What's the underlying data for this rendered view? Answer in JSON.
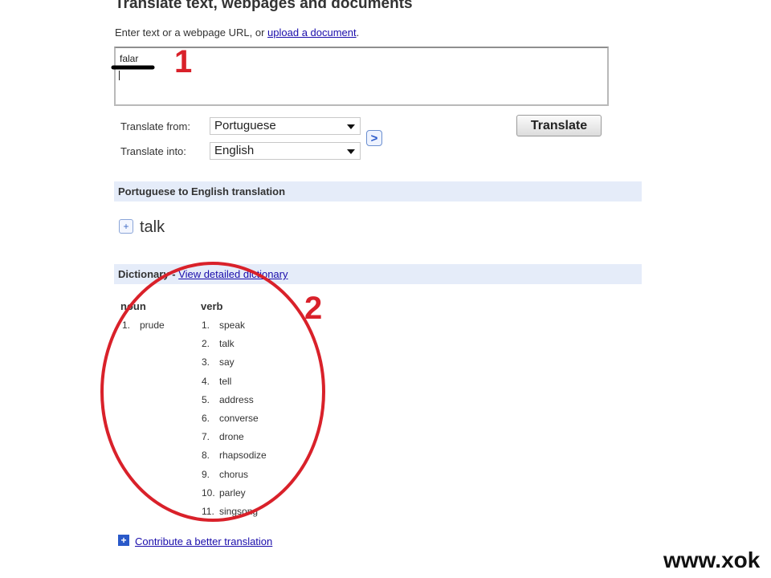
{
  "header": {
    "title": "Translate text, webpages and documents",
    "subtitle_prefix": "Enter text or a webpage URL, or ",
    "upload_link": "upload a document",
    "subtitle_suffix": "."
  },
  "input": {
    "value": "falar"
  },
  "controls": {
    "from_label": "Translate from:",
    "from_value": "Portuguese",
    "into_label": "Translate into:",
    "into_value": "English",
    "translate_button": "Translate"
  },
  "result_bar": {
    "label": "Portuguese to English translation"
  },
  "result": {
    "text": "talk"
  },
  "dictionary": {
    "label": "Dictionary",
    "link": "View detailed dictionary",
    "noun_head": "noun",
    "noun_items": [
      {
        "n": "1.",
        "w": "prude"
      }
    ],
    "verb_head": "verb",
    "verb_items": [
      {
        "n": "1.",
        "w": "speak"
      },
      {
        "n": "2.",
        "w": "talk"
      },
      {
        "n": "3.",
        "w": "say"
      },
      {
        "n": "4.",
        "w": "tell"
      },
      {
        "n": "5.",
        "w": "address"
      },
      {
        "n": "6.",
        "w": "converse"
      },
      {
        "n": "7.",
        "w": "drone"
      },
      {
        "n": "8.",
        "w": "rhapsodize"
      },
      {
        "n": "9.",
        "w": "chorus"
      },
      {
        "n": "10.",
        "w": "parley"
      },
      {
        "n": "11.",
        "w": "singsong"
      }
    ]
  },
  "footer": {
    "contribute_link": "Contribute a better translation"
  },
  "annotations": {
    "one": "1",
    "two": "2",
    "color": "#d9212a"
  },
  "watermark": "www.xok"
}
